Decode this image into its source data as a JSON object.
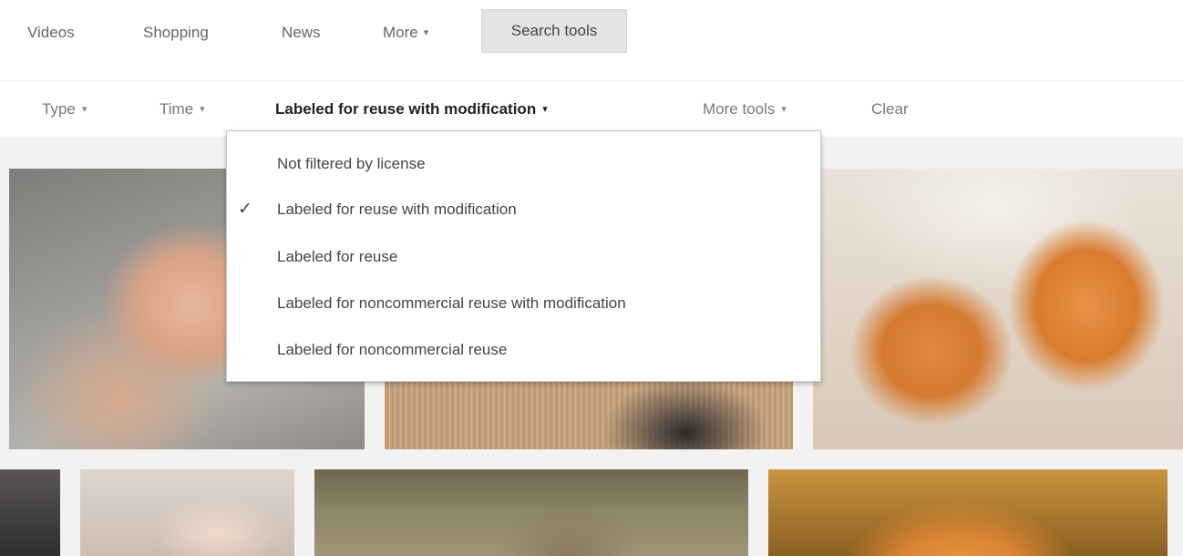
{
  "top_nav": {
    "items": [
      "Videos",
      "Shopping",
      "News",
      "More"
    ],
    "search_tools_label": "Search tools"
  },
  "tools_bar": {
    "type_label": "Type",
    "time_label": "Time",
    "license_label": "Labeled for reuse with modification",
    "more_tools_label": "More tools",
    "clear_label": "Clear"
  },
  "license_dropdown": {
    "selected_index": 1,
    "check_glyph": "✓",
    "options": [
      "Not filtered by license",
      "Labeled for reuse with modification",
      "Labeled for reuse",
      "Labeled for noncommercial reuse with modification",
      "Labeled for noncommercial reuse"
    ]
  },
  "icons": {
    "caret": "▾"
  }
}
